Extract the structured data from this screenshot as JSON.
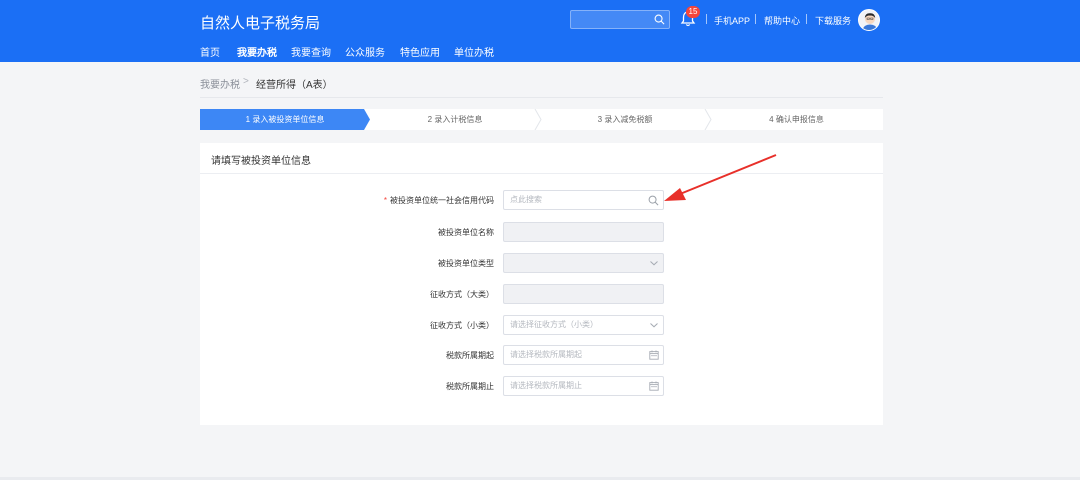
{
  "header": {
    "brand": "自然人电子税务局",
    "notification_count": "15",
    "links": [
      "手机APP",
      "帮助中心",
      "下载服务"
    ],
    "nav": [
      {
        "label": "首页",
        "active": false
      },
      {
        "label": "我要办税",
        "active": true
      },
      {
        "label": "我要查询",
        "active": false
      },
      {
        "label": "公众服务",
        "active": false
      },
      {
        "label": "特色应用",
        "active": false
      },
      {
        "label": "单位办税",
        "active": false
      }
    ]
  },
  "breadcrumb": {
    "parent": "我要办税",
    "separator": ">",
    "current": "经营所得（A表）"
  },
  "steps": [
    {
      "label": "1 录入被投资单位信息",
      "active": true
    },
    {
      "label": "2 录入计税信息",
      "active": false
    },
    {
      "label": "3 录入减免税额",
      "active": false
    },
    {
      "label": "4 确认申报信息",
      "active": false
    }
  ],
  "form": {
    "title": "请填写被投资单位信息",
    "required_mark": "*",
    "fields": [
      {
        "label": "被投资单位统一社会信用代码",
        "placeholder": "点此搜索"
      },
      {
        "label": "被投资单位名称",
        "placeholder": ""
      },
      {
        "label": "被投资单位类型",
        "placeholder": ""
      },
      {
        "label": "征收方式（大类）",
        "placeholder": ""
      },
      {
        "label": "征收方式（小类）",
        "placeholder": "请选择征收方式（小类）"
      },
      {
        "label": "税款所属期起",
        "placeholder": "请选择税款所属期起"
      },
      {
        "label": "税款所属期止",
        "placeholder": "请选择税款所属期止"
      }
    ]
  },
  "colors": {
    "primary": "#1b6ff5",
    "step_active": "#3d87f5",
    "required": "#f5453b",
    "annotation_arrow": "#e8302a"
  }
}
